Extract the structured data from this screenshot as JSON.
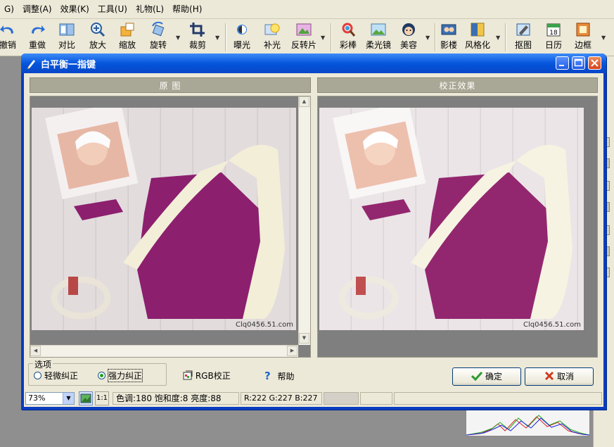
{
  "menubar": {
    "items": [
      "G)",
      "调整(A)",
      "效果(K)",
      "工具(U)",
      "礼物(L)",
      "帮助(H)"
    ]
  },
  "toolbar": {
    "items": [
      {
        "label": "撤销",
        "icon": "undo-icon"
      },
      {
        "label": "重做",
        "icon": "redo-icon"
      },
      {
        "label": "对比",
        "icon": "compare-icon"
      },
      {
        "label": "放大",
        "icon": "zoom-in-icon"
      },
      {
        "label": "缩放",
        "icon": "resize-icon"
      },
      {
        "label": "旋转",
        "icon": "rotate-icon"
      },
      {
        "label": "裁剪",
        "icon": "crop-icon"
      },
      {
        "label": "曝光",
        "icon": "exposure-icon"
      },
      {
        "label": "补光",
        "icon": "fill-light-icon"
      },
      {
        "label": "反转片",
        "icon": "reversal-film-icon"
      },
      {
        "label": "彩棒",
        "icon": "color-wand-icon"
      },
      {
        "label": "柔光镜",
        "icon": "soft-light-icon"
      },
      {
        "label": "美容",
        "icon": "beauty-icon"
      },
      {
        "label": "影楼",
        "icon": "studio-icon"
      },
      {
        "label": "风格化",
        "icon": "stylize-icon"
      },
      {
        "label": "抠图",
        "icon": "cutout-icon"
      },
      {
        "label": "日历",
        "icon": "calendar-icon"
      },
      {
        "label": "边框",
        "icon": "border-icon"
      }
    ],
    "calendar_day": "18"
  },
  "dialog": {
    "title": "白平衡一指键",
    "original_header": "原 图",
    "corrected_header": "校正效果",
    "watermark": "Clq0456.51.com",
    "options_title": "选项",
    "option_light": "轻微纠正",
    "option_strong": "强力纠正",
    "selected_option": "option_strong",
    "rgb_button": "RGB校正",
    "help_button": "帮助",
    "ok_button": "确定",
    "cancel_button": "取消",
    "zoom_value": "73%",
    "actual_size_button": "1:1",
    "status_adjust": "色调:180 饱和度:8 亮度:88",
    "status_rgb": "R:222 G:227 B:227"
  },
  "colors": {
    "title_blue": "#0a5ae0",
    "dialog_bg": "#ece9d8",
    "sweater": "#8c1f6e",
    "scarf": "#f3eed8",
    "ok_check": "#2f9a2f",
    "cancel_x": "#d23a1e"
  }
}
